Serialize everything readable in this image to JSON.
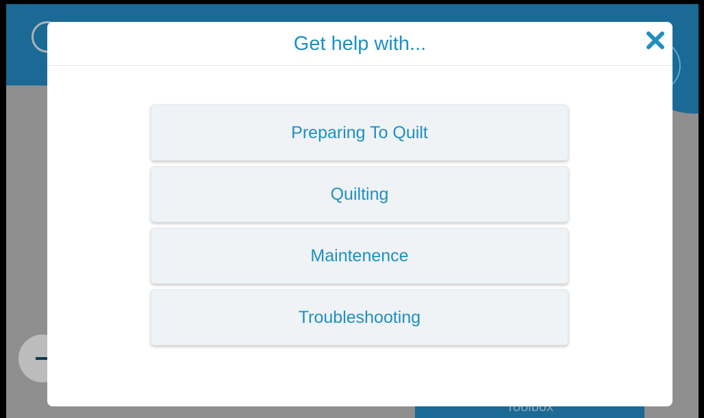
{
  "background": {
    "toolbox_label": "Toolbox"
  },
  "dialog": {
    "title": "Get help with...",
    "close_icon": "close-icon",
    "topics": [
      {
        "label": "Preparing To Quilt"
      },
      {
        "label": "Quilting"
      },
      {
        "label": "Maintenence"
      },
      {
        "label": "Troubleshooting"
      }
    ]
  },
  "colors": {
    "accent": "#1e8fc3",
    "header": "#1a6a95",
    "overlay": "#8f8f8f",
    "button_bg": "#f0f3f5"
  }
}
